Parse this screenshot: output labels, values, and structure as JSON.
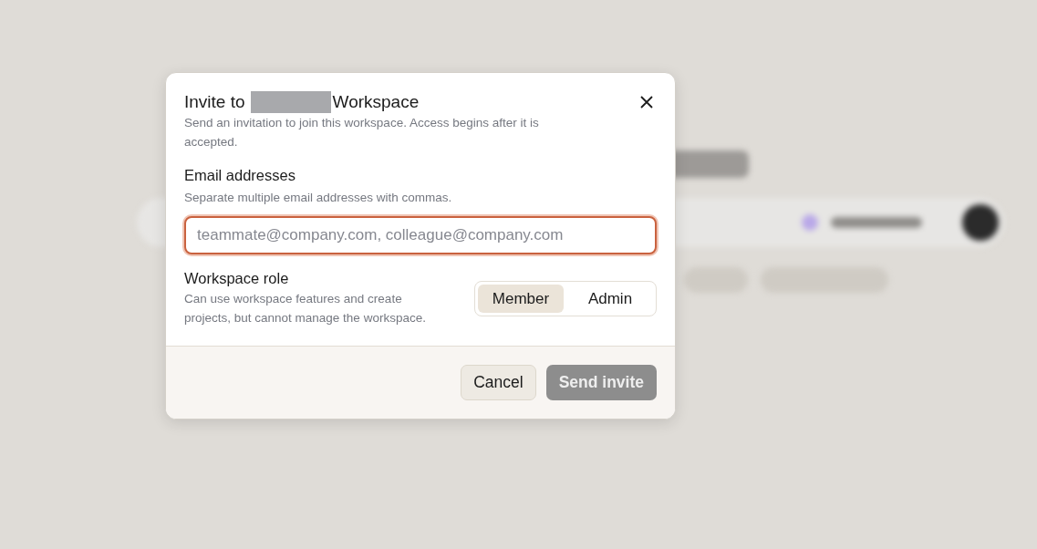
{
  "dialog": {
    "title_prefix": "Invite to",
    "title_redacted": true,
    "title_suffix": "Workspace",
    "description": "Send an invitation to join this workspace. Access begins after it is accepted.",
    "email": {
      "label": "Email addresses",
      "hint": "Separate multiple email addresses with commas.",
      "placeholder": "teammate@company.com, colleague@company.com",
      "focused": true
    },
    "role": {
      "label": "Workspace role",
      "description": "Can use workspace features and create projects, but cannot manage the workspace.",
      "options": [
        {
          "label": "Member",
          "selected": true
        },
        {
          "label": "Admin",
          "selected": false
        }
      ]
    },
    "buttons": [
      {
        "label": "Cancel",
        "kind": "secondary",
        "disabled": false
      },
      {
        "label": "Send invite",
        "kind": "primary",
        "disabled": true
      }
    ]
  }
}
